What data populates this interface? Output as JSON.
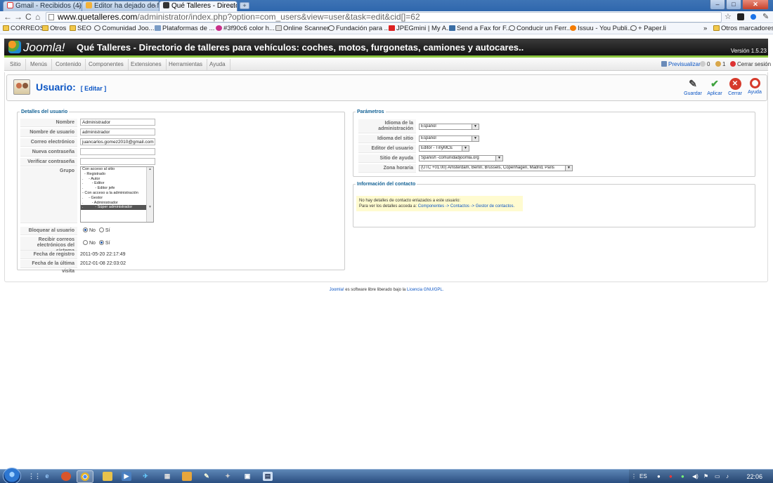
{
  "browser": {
    "tabs": [
      {
        "title": "Gmail - Recibidos (4)",
        "active": false
      },
      {
        "title": "Editor ha dejado de f",
        "active": false
      },
      {
        "title": "Qué Talleres - Directo",
        "active": true
      }
    ],
    "url_host": "www.quetalleres.com",
    "url_path": "/administrator/index.php?option=com_users&view=user&task=edit&cid[]=62",
    "bookmarks": [
      "CORREOS",
      "Otros",
      "SEO",
      "Comunidad Joo...",
      "Plataformas de ...",
      "#3f90c6 color h...",
      "Online Scanner",
      "Fundación para ...",
      "JPEGmini | My A...",
      "Send a Fax for F...",
      "Conducir un Ferr...",
      "Issuu - You Publi...",
      "+ Paper.li"
    ],
    "other_bookmarks": "Otros marcadores",
    "bookmarks_overflow": "»"
  },
  "joomla": {
    "logo_text": "Joomla!",
    "site_title": "Qué Talleres - Directorio de talleres para vehículos: coches, motos, furgonetas, camiones y autocares..",
    "version": "Versión 1.5.23",
    "menu": [
      "Sitio",
      "Menús",
      "Contenido",
      "Componentes",
      "Extensiones",
      "Herramientas",
      "Ayuda"
    ],
    "status": {
      "preview": "Previsualizar",
      "messages": "0",
      "users": "1",
      "logout": "Cerrar sesión"
    },
    "page_title": "Usuario:",
    "page_subtitle": "[ Editar ]",
    "actions": [
      "Guardar",
      "Aplicar",
      "Cerrar",
      "Ayuda"
    ]
  },
  "details": {
    "legend": "Detalles del usuario",
    "fields": [
      {
        "label": "Nombre",
        "value": "Administrador"
      },
      {
        "label": "Nombre de usuario",
        "value": "administrador"
      },
      {
        "label": "Correo electrónico",
        "value": "juancarlos.gomez2010@gmail.com"
      },
      {
        "label": "Nueva contraseña",
        "value": ""
      },
      {
        "label": "Verificar contraseña",
        "value": ""
      }
    ],
    "group_label": "Grupo",
    "groups": [
      "Con acceso al sitio",
      "  - Registrado",
      ".     - Autor",
      ".        - Editor",
      ".           - Editor jefe",
      "- Con acceso a la administración",
      ".     - Gestor",
      ".        - Administrador",
      ".           - Súper administrador"
    ],
    "block_label": "Bloquear al usuario",
    "block_options": [
      "No",
      "Sí"
    ],
    "emails_label": "Recibir correos electrónicos del sistema",
    "emails_options": [
      "No",
      "Sí"
    ],
    "register_date_label": "Fecha de registro",
    "register_date": "2011-05-20 22:17:49",
    "last_visit_label": "Fecha de la última visita",
    "last_visit": "2012-01-08 22:03:02"
  },
  "params": {
    "legend": "Parámetros",
    "fields": [
      {
        "label": "Idioma de la administración",
        "value": "Español"
      },
      {
        "label": "Idioma del sitio",
        "value": "Español"
      },
      {
        "label": "Editor del usuario",
        "value": "Editor - TinyMCE"
      },
      {
        "label": "Sitio de ayuda",
        "value": "Spanish -comunidadjoomla.org"
      },
      {
        "label": "Zona horaria",
        "value": "(UTC +01:00) Amsterdam, Berlin, Brussels, Copenhagen, Madrid, Paris"
      }
    ]
  },
  "contact": {
    "legend": "Información del contacto",
    "line1": "No hay detalles de contacto enlazados a este usuario:",
    "line2_prefix": "Para ver los detalles acceda a:",
    "line2_link": "Componentes -> Contactos -> Gestor de contactos."
  },
  "footer": {
    "link1": "Joomla!",
    "text": "es software libre liberado bajo la",
    "link2": "Licencia GNU/GPL."
  },
  "taskbar": {
    "lang": "ES",
    "time": "22:06"
  }
}
